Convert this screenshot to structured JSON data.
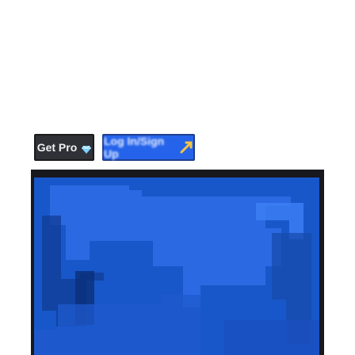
{
  "toolbar": {
    "get_pro_label": "Get Pro",
    "login_label": "Log In/Sign Up"
  },
  "icons": {
    "get_pro_icon": "gem-icon",
    "login_icon": "login-icon"
  },
  "colors": {
    "get_pro_bg": "#2f3137",
    "login_bg": "#2563eb",
    "map_bg": "#1a50b9"
  }
}
